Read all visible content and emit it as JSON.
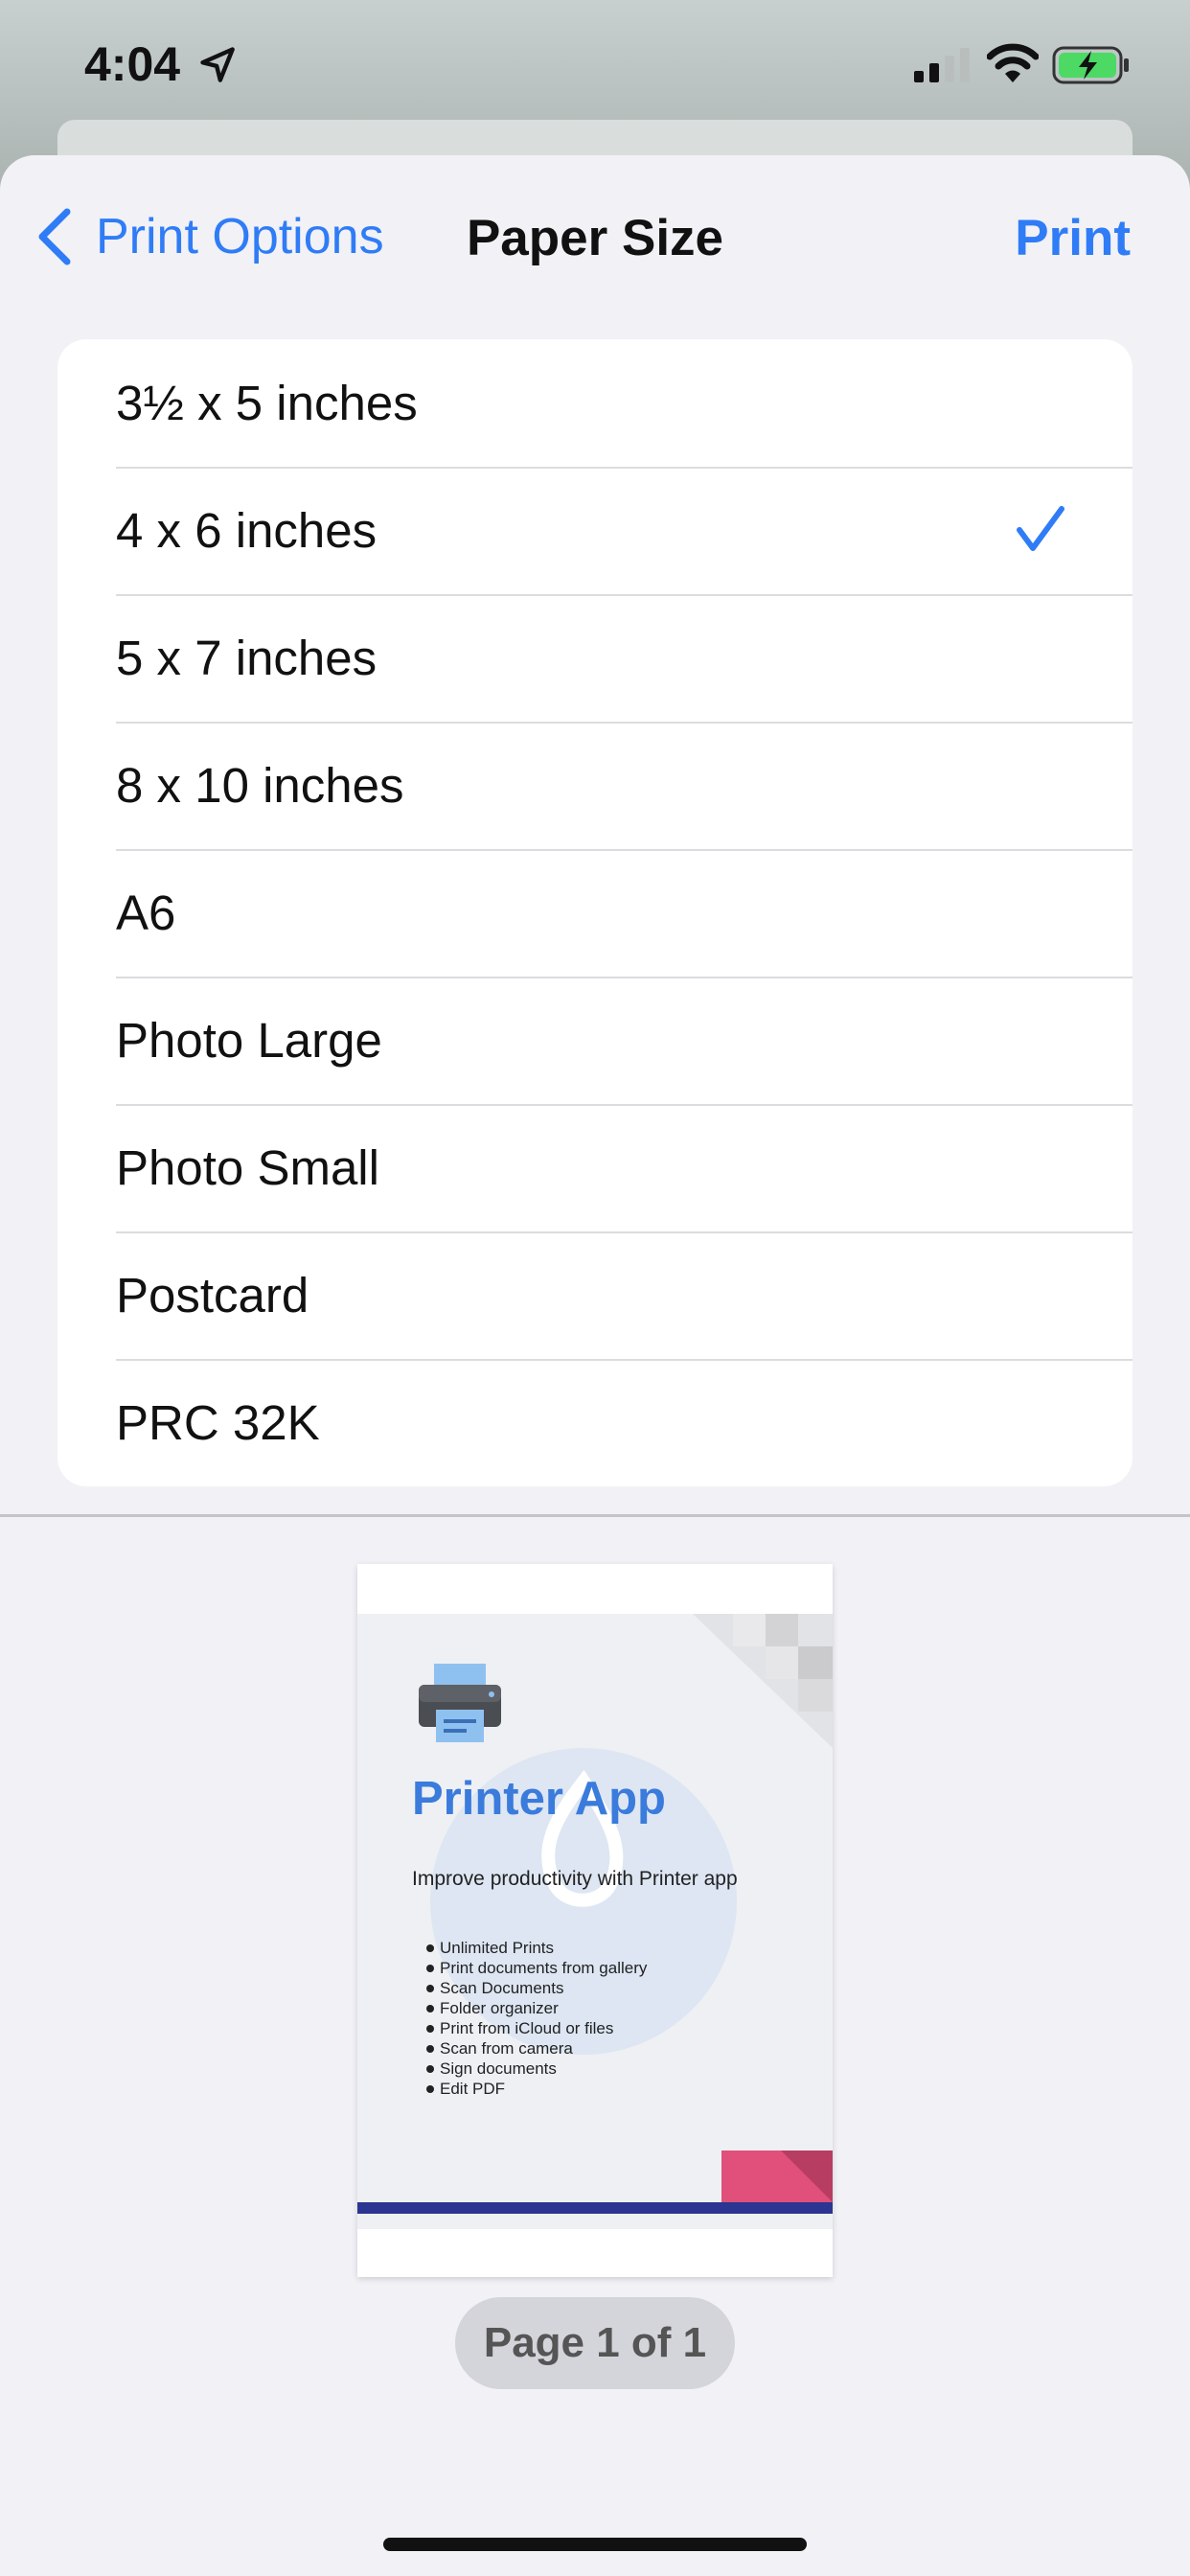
{
  "status_bar": {
    "time": "4:04",
    "icons": [
      "location-arrow-icon",
      "signal-icon",
      "wifi-icon",
      "battery-charging-icon"
    ]
  },
  "nav": {
    "back_label": "Print Options",
    "title": "Paper Size",
    "action_label": "Print"
  },
  "paper_sizes": {
    "items": [
      {
        "label": "3½ x 5 inches",
        "selected": false
      },
      {
        "label": "4 x 6 inches",
        "selected": true
      },
      {
        "label": "5 x 7 inches",
        "selected": false
      },
      {
        "label": "8 x 10 inches",
        "selected": false
      },
      {
        "label": "A6",
        "selected": false
      },
      {
        "label": "Photo Large",
        "selected": false
      },
      {
        "label": "Photo Small",
        "selected": false
      },
      {
        "label": "Postcard",
        "selected": false
      },
      {
        "label": "PRC 32K",
        "selected": false
      }
    ]
  },
  "preview": {
    "title": "Printer App",
    "subtitle": "Improve productivity with Printer app",
    "features": [
      "Unlimited Prints",
      "Print documents from gallery",
      "Scan Documents",
      "Folder organizer",
      "Print from iCloud or files",
      "Scan from camera",
      "Sign documents",
      "Edit PDF"
    ],
    "page_indicator": "Page 1 of 1"
  },
  "colors": {
    "accent": "#2f7cf6",
    "sheet_background": "#f1f1f6",
    "preview_title": "#3a7bdc"
  }
}
